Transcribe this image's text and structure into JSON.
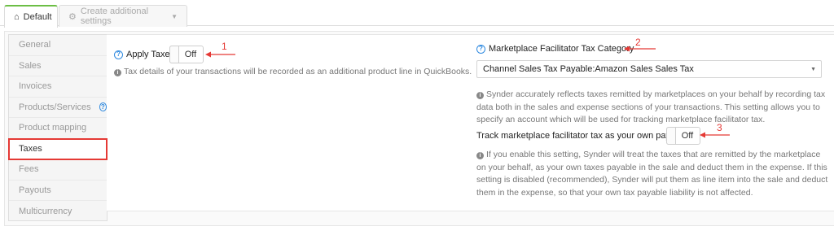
{
  "tabs": {
    "default_label": "Default",
    "create_label": "Create additional settings",
    "colors": {
      "active_accent": "#6cbe45"
    }
  },
  "sidebar": {
    "items": [
      {
        "label": "General"
      },
      {
        "label": "Sales"
      },
      {
        "label": "Invoices"
      },
      {
        "label": "Products/Services"
      },
      {
        "label": "Product mapping"
      },
      {
        "label": "Taxes",
        "active": true
      },
      {
        "label": "Fees"
      },
      {
        "label": "Payouts"
      },
      {
        "label": "Multicurrency"
      }
    ],
    "help_icon": "question-circle-icon"
  },
  "apply_taxes": {
    "label": "Apply Taxes",
    "toggle": "Off",
    "info": "Tax details of your transactions will be recorded as an additional product line in QuickBooks."
  },
  "facilitator": {
    "label": "Marketplace Facilitator Tax Category",
    "selected": "Channel Sales Tax Payable:Amazon Sales Sales Tax",
    "info": "Synder accurately reflects taxes remitted by marketplaces on your behalf by recording tax data both in the sales and expense sections of your transactions. This setting allows you to specify an account which will be used for tracking marketplace facilitator tax.",
    "track_label": "Track marketplace facilitator tax as your own payable",
    "track_toggle": "Off",
    "track_info": "If you enable this setting, Synder will treat the taxes that are remitted by the marketplace on your behalf, as your own taxes payable in the sale and deduct them in the expense. If this setting is disabled (recommended), Synder will put them as line item into the sale and deduct them in the expense, so that your own tax payable liability is not affected."
  },
  "annotations": {
    "numbers": [
      "1",
      "2",
      "3"
    ],
    "color": "#e53935"
  }
}
